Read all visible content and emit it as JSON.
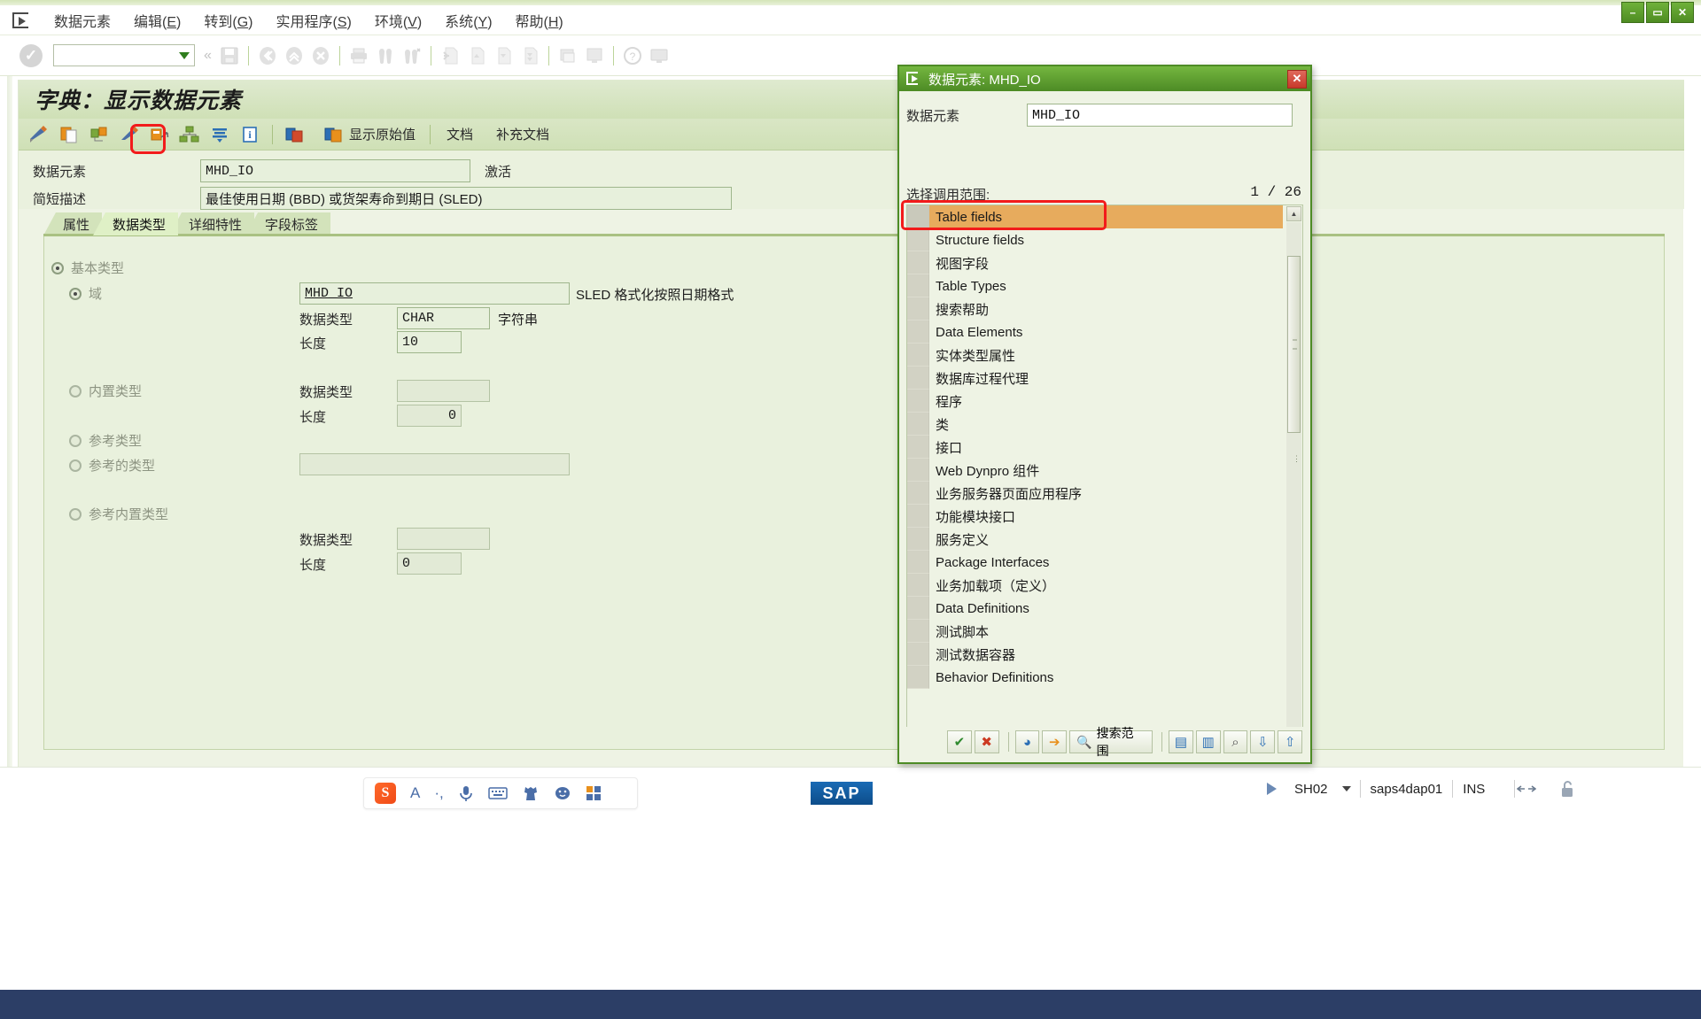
{
  "window": {
    "minimize": "–",
    "maximize": "▭",
    "close": "✕"
  },
  "menubar": {
    "system_icon": "exit-arrow-icon",
    "items": [
      {
        "label": "数据元素",
        "accel": ""
      },
      {
        "label": "编辑",
        "accel": "E"
      },
      {
        "label": "转到",
        "accel": "G"
      },
      {
        "label": "实用程序",
        "accel": "S"
      },
      {
        "label": "环境",
        "accel": "V"
      },
      {
        "label": "系统",
        "accel": "Y"
      },
      {
        "label": "帮助",
        "accel": "H"
      }
    ]
  },
  "standard_toolbar": {
    "command_field_value": "",
    "command_field_placeholder": "",
    "ok_icon": "check-circle-icon",
    "icons": [
      "save-icon",
      "back-icon",
      "exit-icon",
      "cancel-icon",
      "print-icon",
      "find-icon",
      "find-next-icon",
      "first-page-icon",
      "previous-page-icon",
      "next-page-icon",
      "last-page-icon",
      "create-session-icon",
      "create-shortcut-icon",
      "help-icon",
      "customize-local-layout-icon"
    ]
  },
  "screen": {
    "title": "字典：显示数据元素"
  },
  "app_toolbar": {
    "icons": [
      {
        "name": "display-change-icon",
        "label": ""
      },
      {
        "name": "copy-icon",
        "label": ""
      },
      {
        "name": "other-object-icon",
        "label": ""
      },
      {
        "name": "change-icon",
        "label": ""
      },
      {
        "name": "where-used-list-icon",
        "label": "",
        "highlighted": true
      },
      {
        "name": "hierarchy-icon",
        "label": ""
      },
      {
        "name": "activate-icon",
        "label": ""
      },
      {
        "name": "info-icon",
        "label": ""
      }
    ],
    "icons2": [
      {
        "name": "technical-settings-icon",
        "label": ""
      },
      {
        "name": "display-original-values-icon",
        "label": "显示原始值"
      }
    ],
    "text_buttons": [
      "文档",
      "补充文档"
    ]
  },
  "header_form": {
    "data_element_label": "数据元素",
    "data_element_value": "MHD_IO",
    "status_text": "激活",
    "short_desc_label": "简短描述",
    "short_desc_value": "最佳使用日期 (BBD) 或货架寿命到期日 (SLED)"
  },
  "tabs": [
    {
      "label": "属性",
      "active": false
    },
    {
      "label": "数据类型",
      "active": true
    },
    {
      "label": "详细特性",
      "active": false
    },
    {
      "label": "字段标签",
      "active": false
    }
  ],
  "data_type_panel": {
    "elementary_type": {
      "label": "基本类型",
      "selected": true
    },
    "domain": {
      "label": "域",
      "value": "MHD_IO",
      "selected": true,
      "hint": "SLED 格式化按照日期格式"
    },
    "domain_datatype_label": "数据类型",
    "domain_datatype_value": "CHAR",
    "domain_datatype_desc": "字符串",
    "domain_length_label": "长度",
    "domain_length_value": "10",
    "builtin_type": {
      "label": "内置类型",
      "selected": false,
      "datatype_label": "数据类型",
      "datatype_value": "",
      "length_label": "长度",
      "length_value": "0"
    },
    "reference_type": {
      "label": "参考类型",
      "selected": false,
      "ref_to_label": "参考的类型",
      "ref_to_value": "",
      "ref_to_selected": false
    },
    "reference_builtin_type": {
      "label": "参考内置类型",
      "selected": false,
      "datatype_label": "数据类型",
      "datatype_value": "",
      "length_label": "长度",
      "length_value": "0"
    }
  },
  "dialog": {
    "title": "数据元素: MHD_IO",
    "title_icon": "exit-arrow-icon",
    "close_label": "✕",
    "field_label": "数据元素",
    "field_value": "MHD_IO",
    "scope_label": "选择调用范围:",
    "counter_current": "1",
    "counter_sep": "/",
    "counter_total": "26",
    "items": [
      {
        "label": "Table fields",
        "selected": true
      },
      {
        "label": "Structure fields",
        "selected": false
      },
      {
        "label": "视图字段",
        "selected": false
      },
      {
        "label": "Table Types",
        "selected": false
      },
      {
        "label": "搜索帮助",
        "selected": false
      },
      {
        "label": "Data Elements",
        "selected": false
      },
      {
        "label": "实体类型属性",
        "selected": false
      },
      {
        "label": "数据库过程代理",
        "selected": false
      },
      {
        "label": "程序",
        "selected": false
      },
      {
        "label": "类",
        "selected": false
      },
      {
        "label": "接口",
        "selected": false
      },
      {
        "label": "Web Dynpro 组件",
        "selected": false
      },
      {
        "label": "业务服务器页面应用程序",
        "selected": false
      },
      {
        "label": "功能模块接口",
        "selected": false
      },
      {
        "label": "服务定义",
        "selected": false
      },
      {
        "label": "Package Interfaces",
        "selected": false
      },
      {
        "label": "业务加载项（定义）",
        "selected": false
      },
      {
        "label": "Data Definitions",
        "selected": false
      },
      {
        "label": "测试脚本",
        "selected": false
      },
      {
        "label": "测试数据容器",
        "selected": false
      },
      {
        "label": "Behavior Definitions",
        "selected": false
      }
    ],
    "buttons": [
      {
        "name": "confirm-button",
        "glyph": "✔",
        "label": ""
      },
      {
        "name": "cancel-button",
        "glyph": "✖",
        "label": ""
      },
      {
        "name": "clock-button",
        "glyph": "◕",
        "label": ""
      },
      {
        "name": "execute-button",
        "glyph": "➔",
        "label": ""
      },
      {
        "name": "search-scope-button",
        "glyph": "🔍",
        "label": "搜索范围"
      },
      {
        "name": "select-all-button",
        "glyph": "▤",
        "label": ""
      },
      {
        "name": "deselect-all-button",
        "glyph": "▥",
        "label": ""
      },
      {
        "name": "find-button",
        "glyph": "⌕",
        "label": ""
      },
      {
        "name": "sort-asc-button",
        "glyph": "⇩",
        "label": ""
      },
      {
        "name": "sort-desc-button",
        "glyph": "⇧",
        "label": ""
      }
    ]
  },
  "taskbar": {
    "ime_logo": "S",
    "ime_items": [
      "A",
      "·,",
      "mic-icon",
      "keyboard-icon",
      "dress-icon",
      "emoji-icon",
      "apps-icon"
    ],
    "sap_logo": "SAP"
  },
  "statusbar": {
    "play_icon": "triangle-right-icon",
    "session": "SH02",
    "system": "saps4dap01",
    "mode": "INS",
    "resize_icon": "resize-icon",
    "lock_icon": "unlock-icon"
  },
  "colors": {
    "accent_green": "#4d8b25",
    "title_bg": "#cfe0b6",
    "panel_bg": "#e9f1dd",
    "selection_orange": "#e7ab5d",
    "highlight_red": "#f21b1b",
    "status_blue": "#2c3e66"
  }
}
